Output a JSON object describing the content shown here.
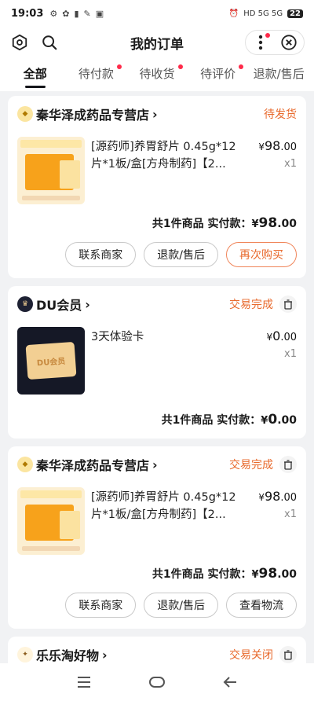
{
  "status_bar": {
    "time": "19:03",
    "notif_icons": [
      "⚙",
      "✿",
      "▮",
      "✎",
      "▣"
    ],
    "network": "HD 5G 5G",
    "battery": "22"
  },
  "header": {
    "title": "我的订单"
  },
  "tabs": [
    {
      "label": "全部",
      "active": true,
      "dot": false
    },
    {
      "label": "待付款",
      "active": false,
      "dot": true
    },
    {
      "label": "待收货",
      "active": false,
      "dot": true
    },
    {
      "label": "待评价",
      "active": false,
      "dot": true
    },
    {
      "label": "退款/售后",
      "active": false,
      "dot": false
    }
  ],
  "orders": [
    {
      "shop": "秦华泽成药品专营店",
      "status": "待发货",
      "item_title": "[源药师]养胃舒片 0.45g*12片*1板/盒[方舟制药]【2...",
      "price_int": "98",
      "price_dec": ".00",
      "qty": "x1",
      "total_label": "共1件商品  实付款：",
      "total_int": "98",
      "total_dec": ".00",
      "buttons": [
        "联系商家",
        "退款/售后",
        "再次购买"
      ]
    },
    {
      "shop": "DU会员",
      "status": "交易完成",
      "item_title": "3天体验卡",
      "price_int": "0",
      "price_dec": ".00",
      "qty": "x1",
      "total_label": "共1件商品  实付款：",
      "total_int": "0",
      "total_dec": ".00",
      "thumb_text": "DU会员"
    },
    {
      "shop": "秦华泽成药品专营店",
      "status": "交易完成",
      "item_title": "[源药师]养胃舒片 0.45g*12片*1板/盒[方舟制药]【2...",
      "price_int": "98",
      "price_dec": ".00",
      "qty": "x1",
      "total_label": "共1件商品  实付款：",
      "total_int": "98",
      "total_dec": ".00",
      "buttons": [
        "联系商家",
        "退款/售后",
        "查看物流"
      ]
    },
    {
      "shop": "乐乐淘好物",
      "status": "交易关闭"
    }
  ],
  "currency": "¥",
  "colors": {
    "accent": "#e8692c",
    "tab_dot": "#ff2a4a"
  }
}
